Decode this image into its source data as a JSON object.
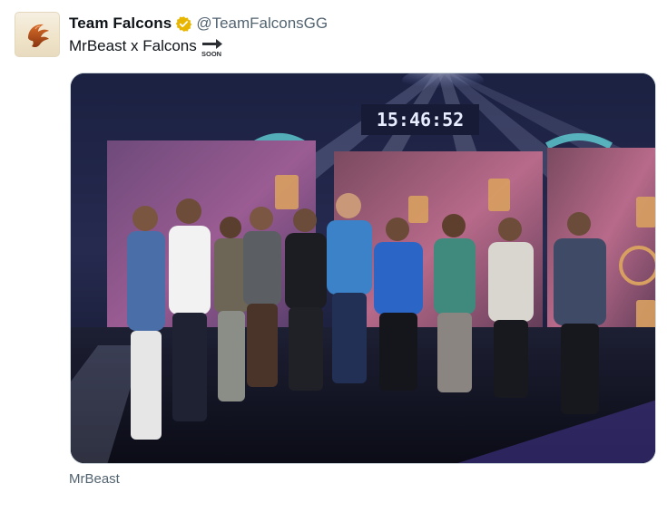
{
  "author": {
    "display_name": "Team Falcons",
    "handle": "@TeamFalconsGG",
    "verified_badge": "verified-gold-badge-icon",
    "avatar_icon": "falcon-logo-icon"
  },
  "tweet": {
    "text": "MrBeast x Falcons",
    "emoji_icon": "soon-arrow-icon",
    "emoji_text": "SOON"
  },
  "media": {
    "screen_clock": "15:46:52"
  },
  "caption": "MrBeast",
  "colors": {
    "badge_gold": "#e8b600",
    "handle_gray": "#536471",
    "text_black": "#0f1419"
  }
}
